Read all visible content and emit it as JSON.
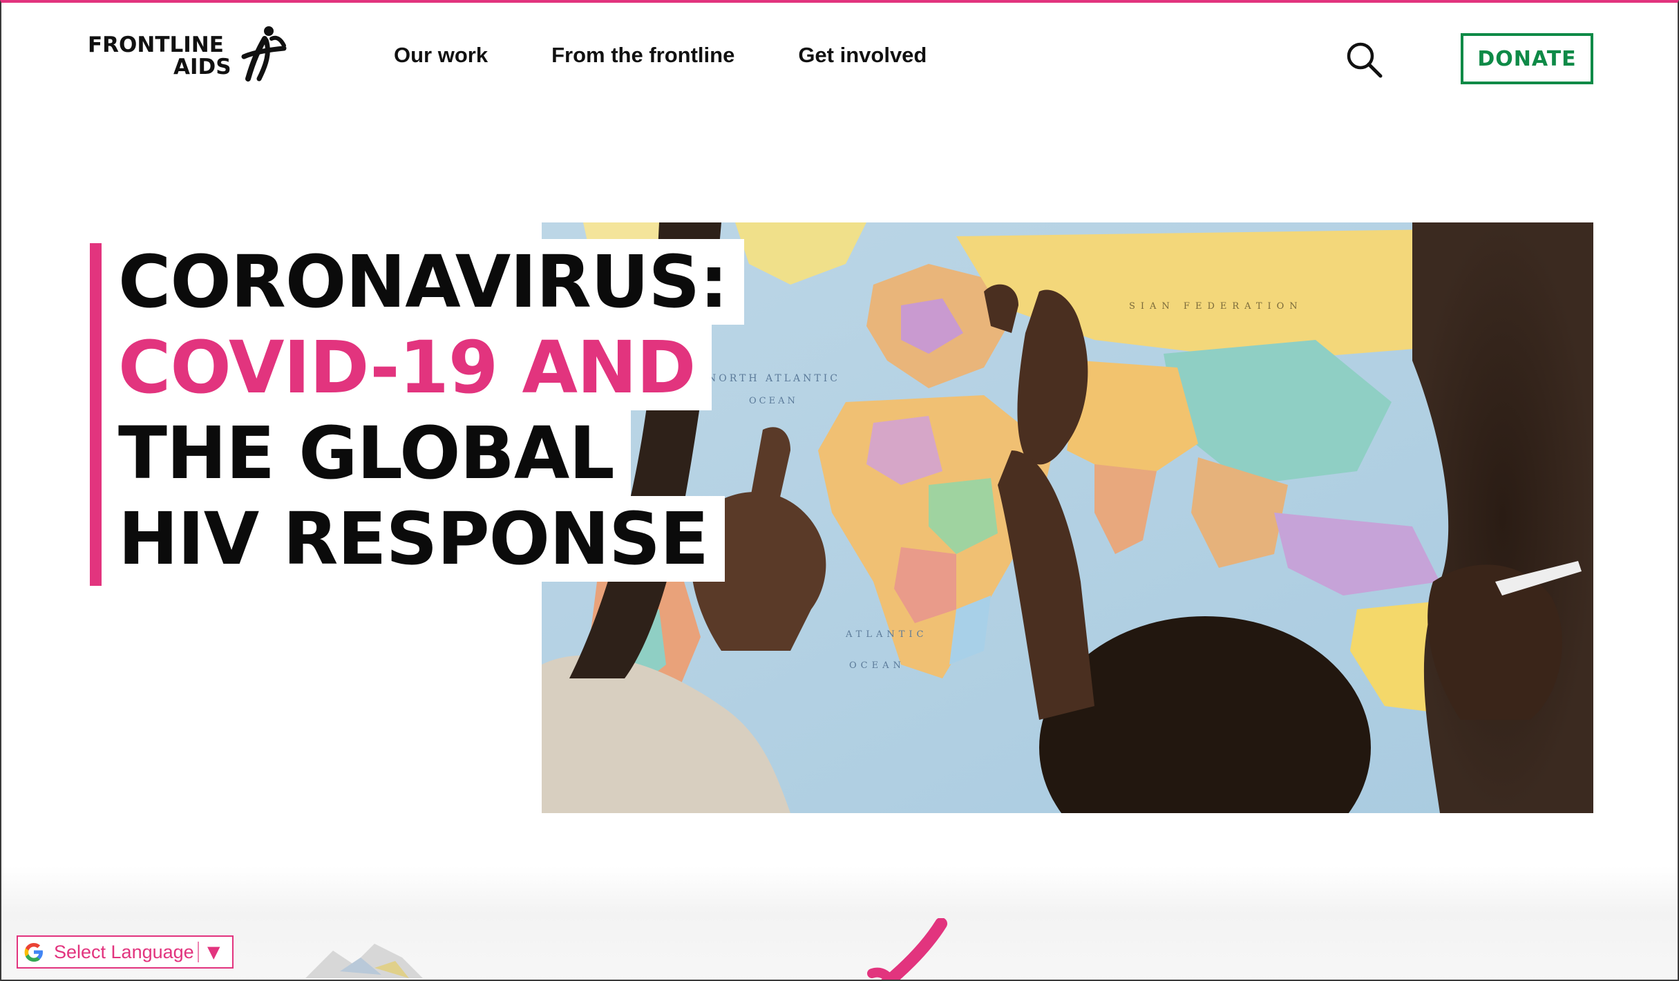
{
  "brand": {
    "logo_line1": "FRONTLINE",
    "logo_line2": "AIDS",
    "logo_icon": "frontline-aids-figure-logo"
  },
  "nav": {
    "items": [
      {
        "label": "Our work"
      },
      {
        "label": "From the frontline"
      },
      {
        "label": "Get involved"
      }
    ]
  },
  "header": {
    "search_icon": "search-icon",
    "donate_label": "DONATE"
  },
  "hero": {
    "headline": {
      "line1": "CORONAVIRUS:",
      "line2": "COVID-19 AND",
      "line3": "THE GLOBAL",
      "line4": "HIV RESPONSE"
    },
    "image_subject": "people pointing at a world map",
    "map_labels": {
      "north_atlantic": "NORTH ATLANTIC",
      "ocean": "OCEAN",
      "russian_federation": "SIAN FEDERATION",
      "atlantic": "ATLANTIC",
      "ocean2": "OCEAN"
    }
  },
  "language": {
    "label": "Select Language",
    "arrow": "▼",
    "icon": "google-g-icon"
  },
  "colors": {
    "accent_pink": "#e2347e",
    "donate_green": "#0e8a47",
    "text_dark": "#111111"
  }
}
